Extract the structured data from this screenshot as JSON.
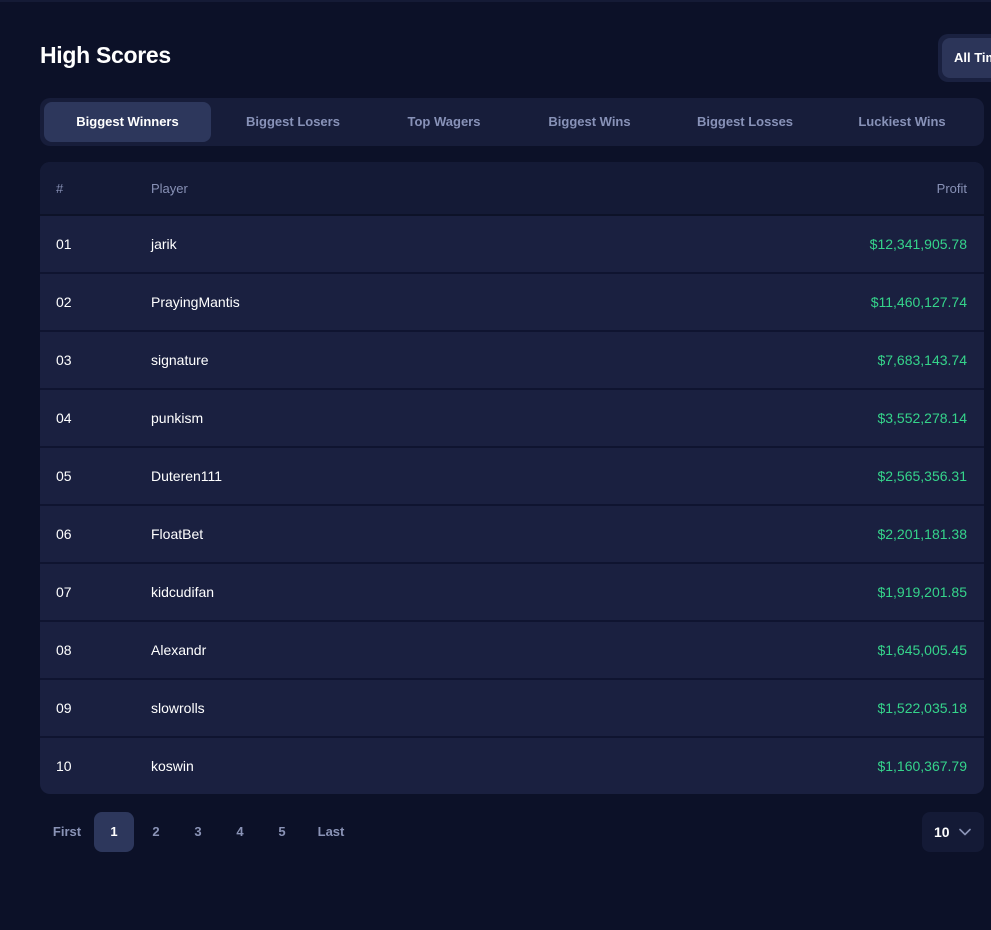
{
  "header": {
    "title": "High Scores",
    "timeframe_label": "All Time"
  },
  "tabs": [
    {
      "label": "Biggest Winners",
      "active": true
    },
    {
      "label": "Biggest Losers",
      "active": false
    },
    {
      "label": "Top Wagers",
      "active": false
    },
    {
      "label": "Biggest Wins",
      "active": false
    },
    {
      "label": "Biggest Losses",
      "active": false
    },
    {
      "label": "Luckiest Wins",
      "active": false
    }
  ],
  "table": {
    "columns": {
      "rank": "#",
      "player": "Player",
      "profit": "Profit"
    },
    "rows": [
      {
        "rank": "01",
        "player": "jarik",
        "profit": "$12,341,905.78"
      },
      {
        "rank": "02",
        "player": "PrayingMantis",
        "profit": "$11,460,127.74"
      },
      {
        "rank": "03",
        "player": "signature",
        "profit": "$7,683,143.74"
      },
      {
        "rank": "04",
        "player": "punkism",
        "profit": "$3,552,278.14"
      },
      {
        "rank": "05",
        "player": "Duteren111",
        "profit": "$2,565,356.31"
      },
      {
        "rank": "06",
        "player": "FloatBet",
        "profit": "$2,201,181.38"
      },
      {
        "rank": "07",
        "player": "kidcudifan",
        "profit": "$1,919,201.85"
      },
      {
        "rank": "08",
        "player": "Alexandr",
        "profit": "$1,645,005.45"
      },
      {
        "rank": "09",
        "player": "slowrolls",
        "profit": "$1,522,035.18"
      },
      {
        "rank": "10",
        "player": "koswin",
        "profit": "$1,160,367.79"
      }
    ]
  },
  "pagination": {
    "first": "First",
    "pages": [
      "1",
      "2",
      "3",
      "4",
      "5"
    ],
    "current": "1",
    "last": "Last"
  },
  "per_page": {
    "value": "10",
    "icon": "chevron-down-icon"
  },
  "colors": {
    "background": "#0c1128",
    "panel": "#1a2040",
    "accent_active": "#2d375c",
    "profit": "#35d48b",
    "muted_text": "#8891b6"
  }
}
